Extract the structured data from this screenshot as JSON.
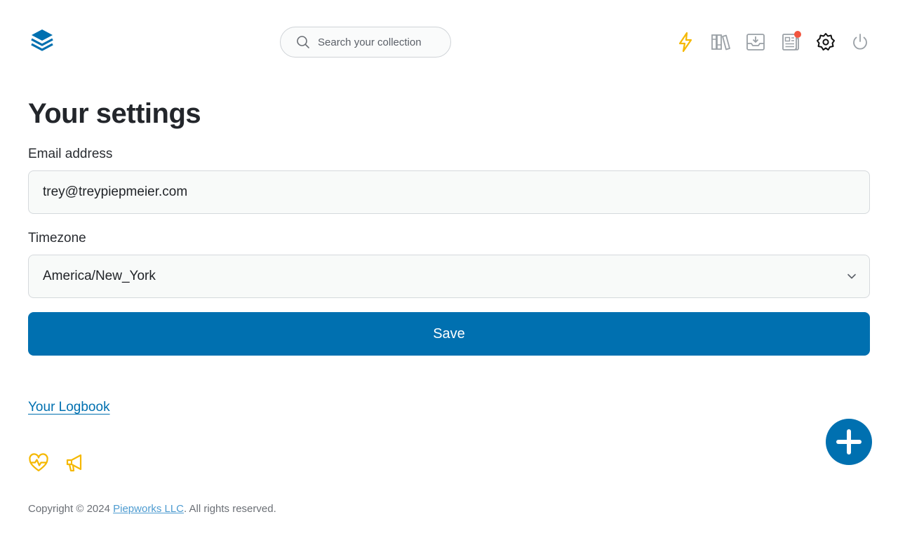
{
  "header": {
    "logo_icon": "stacked-layers-icon",
    "search_placeholder": "Search your collection",
    "nav_icons": [
      {
        "name": "lightning-icon",
        "color": "#f5b800"
      },
      {
        "name": "library-books-icon",
        "color": "#9aa0a6"
      },
      {
        "name": "inbox-download-icon",
        "color": "#9aa0a6"
      },
      {
        "name": "newspaper-icon",
        "color": "#9aa0a6",
        "badge_color": "#f2553f"
      },
      {
        "name": "settings-gear-icon",
        "color": "#111111"
      },
      {
        "name": "power-icon",
        "color": "#9aa0a6"
      }
    ]
  },
  "main": {
    "title": "Your settings",
    "email_label": "Email address",
    "email_value": "trey@treypiepmeier.com",
    "timezone_label": "Timezone",
    "timezone_value": "America/New_York",
    "save_label": "Save"
  },
  "logbook_link": "Your Logbook",
  "footer": {
    "icons": [
      "heart-pulse-icon",
      "megaphone-icon"
    ],
    "copyright_prefix": "Copyright © 2024 ",
    "company_link": "Piepworks LLC",
    "copyright_suffix": ". All rights reserved."
  },
  "colors": {
    "accent": "#0070b0",
    "highlight": "#f5b800",
    "badge": "#f2553f"
  }
}
